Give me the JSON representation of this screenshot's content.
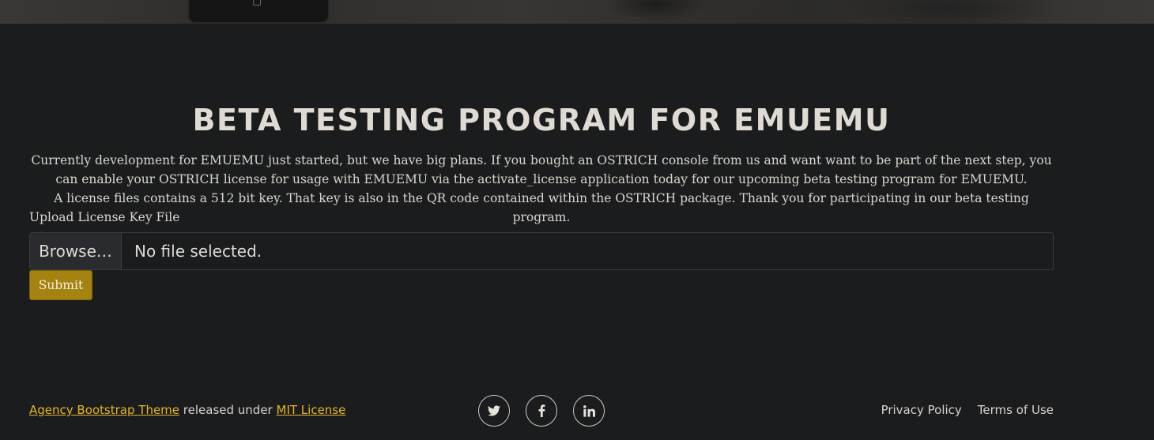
{
  "header": {
    "title": "BETA TESTING PROGRAM FOR EMUEMU"
  },
  "intro": {
    "line1": "Currently development for EMUEMU just started, but we have big plans. If you bought an OSTRICH console from us and want want to be part of the next step, you can enable your OSTRICH license for usage with EMUEMU via the activate_license application today for our upcoming beta testing program for EMUEMU.",
    "line2": "A license files contains a 512 bit key. That key is also in the QR code contained within the OSTRICH package. Thank you for participating in our beta testing program."
  },
  "form": {
    "upload_label": "Upload License Key File",
    "browse_label": "Browse…",
    "file_status": "No file selected.",
    "submit_label": "Submit"
  },
  "footer": {
    "theme_link": "Agency Bootstrap Theme",
    "released_text": " released under ",
    "license_link": "MIT License",
    "social": [
      {
        "icon": "twitter-icon"
      },
      {
        "icon": "facebook-icon"
      },
      {
        "icon": "linkedin-icon"
      }
    ],
    "privacy_link": "Privacy Policy",
    "terms_link": "Terms of Use"
  },
  "colors": {
    "background": "#1b1c1e",
    "accent": "#a48310",
    "link": "#e8b621"
  }
}
